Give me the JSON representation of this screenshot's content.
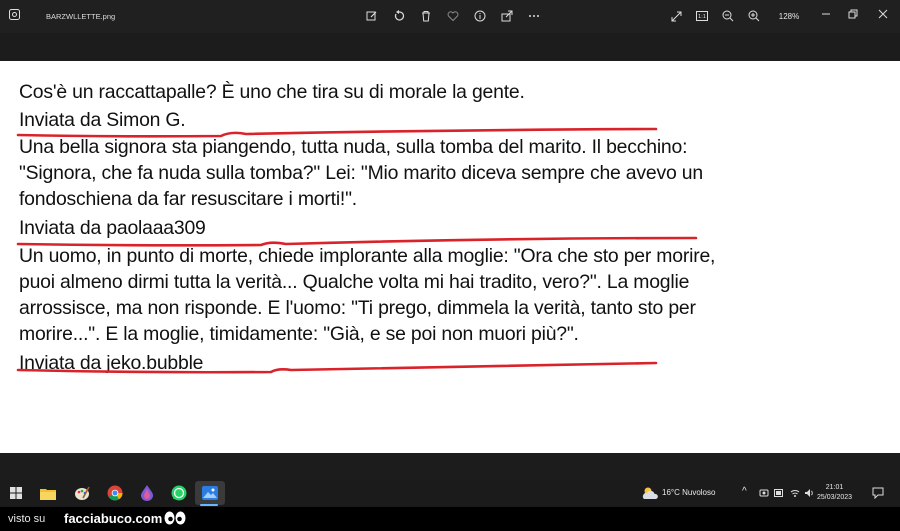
{
  "window": {
    "title": "BARZWLLETTE.png",
    "zoom": "128%",
    "toolbar_icons": [
      "edit-icon",
      "rotate-icon",
      "delete-icon",
      "favorite-icon",
      "info-icon",
      "share-icon",
      "more-icon"
    ],
    "right_icons": [
      "fullscreen-icon",
      "actual-size-icon",
      "zoom-out-icon",
      "zoom-in-icon"
    ],
    "window_controls": [
      "minimize-icon",
      "restore-icon",
      "close-icon"
    ]
  },
  "image_content": {
    "joke1": "Cos'è un raccattapalle? È uno che tira su di morale la gente.",
    "credit1": "Inviata da Simon G.",
    "joke2_lines": [
      "Una bella signora sta piangendo, tutta nuda, sulla tomba del marito. Il becchino:",
      "\"Signora, che fa nuda sulla tomba?\" Lei: \"Mio marito diceva sempre che avevo un",
      "fondoschiena da far resuscitare i morti!\"."
    ],
    "credit2": "Inviata da paolaaa309",
    "joke3_lines": [
      "Un uomo, in punto di morte, chiede implorante alla moglie: \"Ora che sto per morire,",
      "puoi almeno dirmi tutta la verità... Qualche volta mi hai tradito, vero?\". La moglie",
      "arrossisce, ma non risponde. E l'uomo: \"Ti prego, dimmela la verità, tanto sto per",
      "morire...\". E la moglie, timidamente: \"Già, e se poi non muori più?\"."
    ],
    "credit3": "Inviata da jeko.bubble",
    "underline_color": "#d9232a"
  },
  "taskbar": {
    "apps": [
      "windows-start-icon",
      "file-explorer-icon",
      "paint-icon",
      "chrome-icon",
      "app-drop-icon",
      "whatsapp-icon",
      "photos-icon"
    ],
    "weather": "16°C  Nuvoloso",
    "time": "21:01",
    "date": "25/03/2023"
  },
  "watermark": {
    "prefix": "visto su",
    "brand": "facciabuco.com"
  }
}
